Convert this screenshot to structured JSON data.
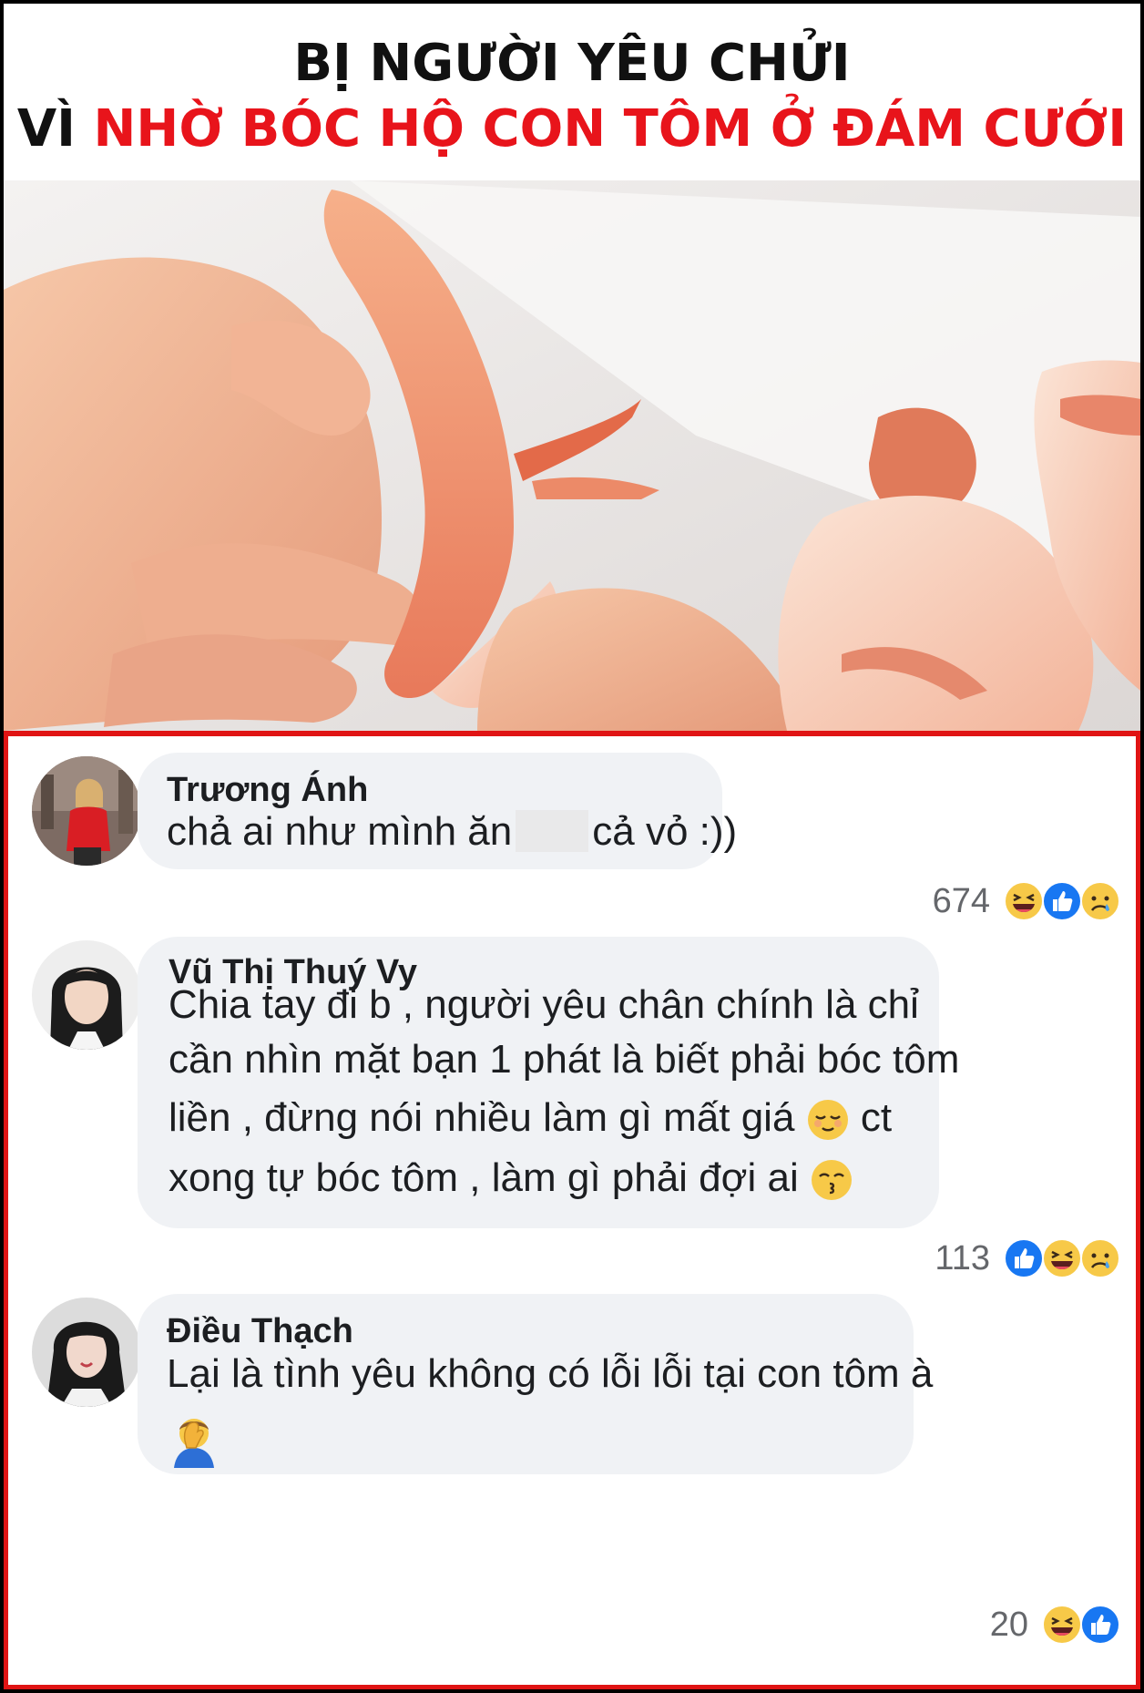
{
  "headline": {
    "line1": "BỊ NGƯỜI YÊU CHỬI",
    "line2_black": "VÌ ",
    "line2_red": "NHỜ BÓC HỘ CON TÔM Ở ĐÁM CƯỚI"
  },
  "colors": {
    "accent_red": "#e8141b",
    "bubble_bg": "#f0f2f5",
    "like_blue": "#1877f2",
    "haha_yellow": "#f7c948"
  },
  "comments": [
    {
      "author": "Trương Ánh",
      "text_before": "chả ai như mình ăn",
      "text_after": "cả vỏ :))",
      "reaction_count": "674",
      "reactions": [
        "haha-icon",
        "like-icon",
        "sad-icon"
      ]
    },
    {
      "author": "Vũ Thị Thuý Vy",
      "lines": [
        "Chia tay đi b , người yêu chân chính là chỉ",
        "cần nhìn mặt bạn 1 phát là biết phải bóc tôm",
        "liền , đừng nói nhiều làm gì mất giá",
        "xong tự bóc tôm , làm gì phải đợi ai"
      ],
      "line3_suffix": "ct",
      "reaction_count": "113",
      "reactions": [
        "like-icon",
        "haha-icon",
        "sad-icon"
      ]
    },
    {
      "author": "Điều Thạch",
      "text": "Lại là tình yêu không có lỗi lỗi tại con tôm à",
      "reaction_count": "20",
      "reactions": [
        "haha-icon",
        "like-icon"
      ]
    }
  ]
}
